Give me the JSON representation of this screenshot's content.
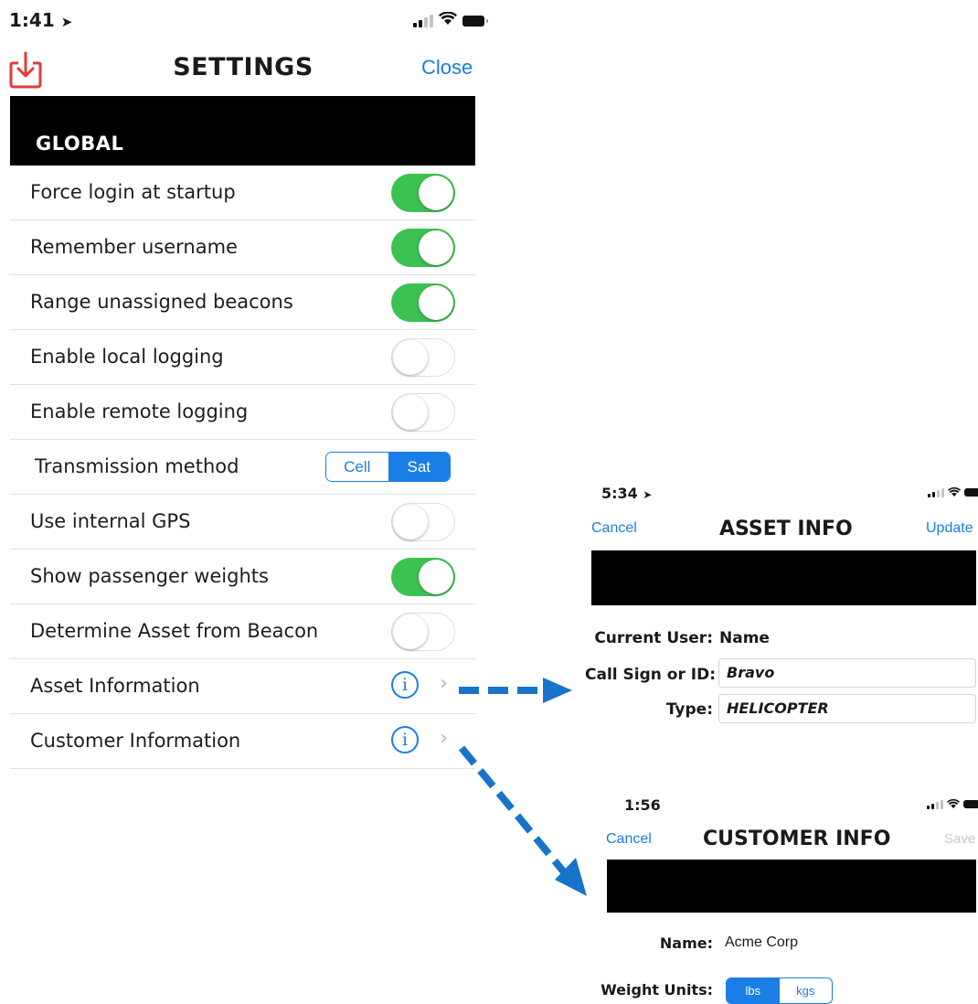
{
  "settings": {
    "status_time": "1:41",
    "title": "SETTINGS",
    "close_label": "Close",
    "section": "GLOBAL",
    "rows": [
      {
        "label": "Force login at startup",
        "control": "toggle",
        "on": true
      },
      {
        "label": "Remember username",
        "control": "toggle",
        "on": true
      },
      {
        "label": "Range unassigned beacons",
        "control": "toggle",
        "on": true
      },
      {
        "label": "Enable local logging",
        "control": "toggle",
        "on": false
      },
      {
        "label": "Enable remote logging",
        "control": "toggle",
        "on": false
      },
      {
        "label": "Transmission method",
        "control": "segment",
        "options": [
          "Cell",
          "Sat"
        ],
        "selected": "Sat"
      },
      {
        "label": "Use internal GPS",
        "control": "toggle",
        "on": false
      },
      {
        "label": "Show passenger weights",
        "control": "toggle",
        "on": true
      },
      {
        "label": "Determine Asset from Beacon",
        "control": "toggle",
        "on": false
      },
      {
        "label": "Asset Information",
        "control": "info"
      },
      {
        "label": "Customer Information",
        "control": "info"
      }
    ]
  },
  "asset": {
    "status_time": "5:34",
    "cancel_label": "Cancel",
    "title": "ASSET INFO",
    "update_label": "Update",
    "current_user_label": "Current User:",
    "current_user_value": "Name",
    "call_sign_label": "Call Sign or ID:",
    "call_sign_value": "Bravo",
    "type_label": "Type:",
    "type_value": "HELICOPTER"
  },
  "customer": {
    "status_time": "1:56",
    "cancel_label": "Cancel",
    "title": "CUSTOMER INFO",
    "save_label": "Save",
    "name_label": "Name:",
    "name_value": "Acme Corp",
    "weight_units_label": "Weight Units:",
    "weight_units_options": [
      "lbs",
      "kgs"
    ],
    "weight_units_selected": "lbs"
  },
  "colors": {
    "accent": "#1a7ee6",
    "toggle_on": "#3cc153",
    "arrow": "#1874c8",
    "header_bar": "#000000"
  }
}
